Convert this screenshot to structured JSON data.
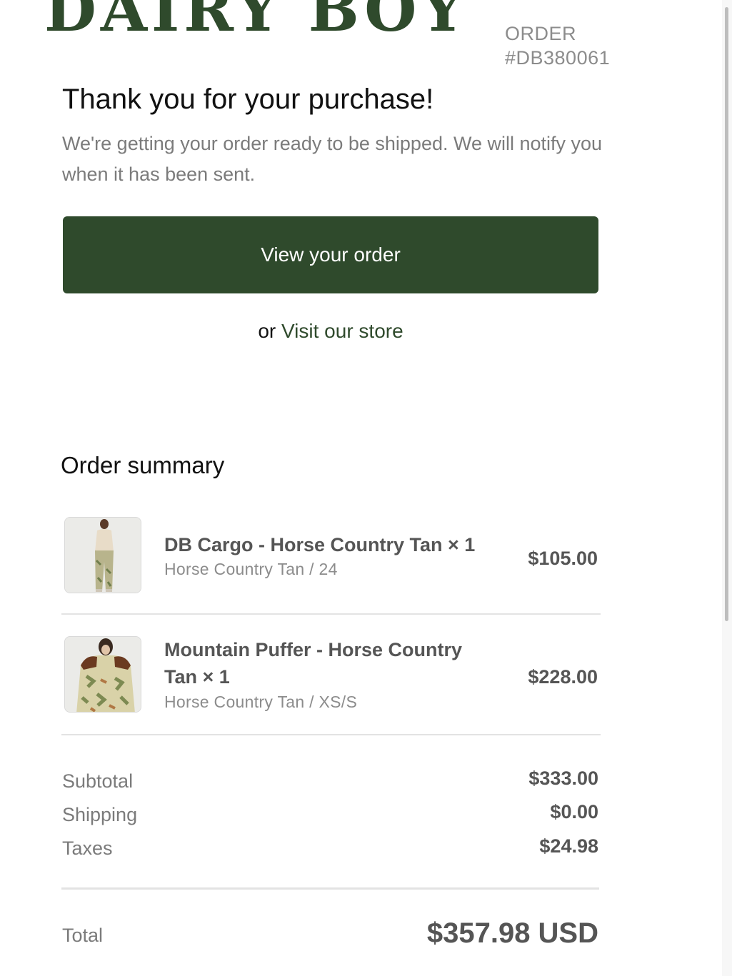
{
  "brand": {
    "logo_text": "DAIRY BOY",
    "color": "#2f4a2c"
  },
  "order": {
    "label": "ORDER",
    "number": "#DB380061"
  },
  "confirmation": {
    "title": "Thank you for your purchase!",
    "body": "We're getting your order ready to be shipped. We will notify you when it has been sent."
  },
  "actions": {
    "view_order_label": "View your order",
    "or_text": "or",
    "visit_store_label": "Visit our store"
  },
  "summary": {
    "title": "Order summary",
    "items": [
      {
        "name": "DB Cargo - Horse Country Tan × 1",
        "variant": "Horse Country Tan / 24",
        "price": "$105.00",
        "thumbnail_icon": "model-cargo-pants-photo"
      },
      {
        "name": "Mountain Puffer - Horse Country Tan × 1",
        "variant": "Horse Country Tan / XS/S",
        "price": "$228.00",
        "thumbnail_icon": "model-puffer-jacket-photo"
      }
    ],
    "subtotal_label": "Subtotal",
    "subtotal_value": "$333.00",
    "shipping_label": "Shipping",
    "shipping_value": "$0.00",
    "taxes_label": "Taxes",
    "taxes_value": "$24.98",
    "total_label": "Total",
    "total_value": "$357.98 USD"
  }
}
